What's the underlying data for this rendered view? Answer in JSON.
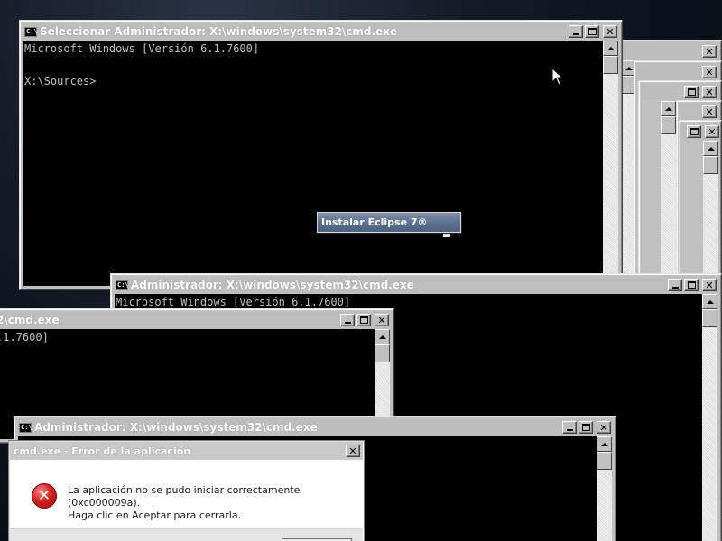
{
  "windows": [
    {
      "id": "cmd1",
      "title": "Seleccionar Administrador: X:\\windows\\system32\\cmd.exe",
      "icon_text": "C:\\",
      "lines": [
        "Microsoft Windows [Versión 6.1.7600]",
        "",
        "X:\\Sources>"
      ]
    },
    {
      "id": "cmd-main",
      "title": "Administrador: X:\\windows\\system32\\cmd.exe",
      "icon_text": "C:\\",
      "lines": [
        "Microsoft Windows [Versión 6.1.7600]"
      ]
    },
    {
      "id": "cmd-left",
      "title": "2\\cmd.exe",
      "lines": [
        ".1.7600]"
      ]
    },
    {
      "id": "cmd-bottom",
      "title": "Administrador: X:\\windows\\system32\\cmd.exe",
      "icon_text": "C:\\"
    }
  ],
  "buttons": {
    "minimize": "_",
    "maximize": "□",
    "close": "✕"
  },
  "tooltip": {
    "label": "Instalar Eclipse 7®"
  },
  "dialog": {
    "title": "cmd.exe - Error de la aplicación",
    "icon": "error-icon",
    "icon_glyph": "✕",
    "message_line1": "La aplicación no se pudo iniciar correctamente (0xc000009a).",
    "message_line2": "Haga clic en Aceptar para cerrarla."
  },
  "colors": {
    "console_bg": "#000000",
    "console_text": "#c0c0c0",
    "tooltip_bg": "#5a6c8c",
    "error_red": "#d42222"
  }
}
